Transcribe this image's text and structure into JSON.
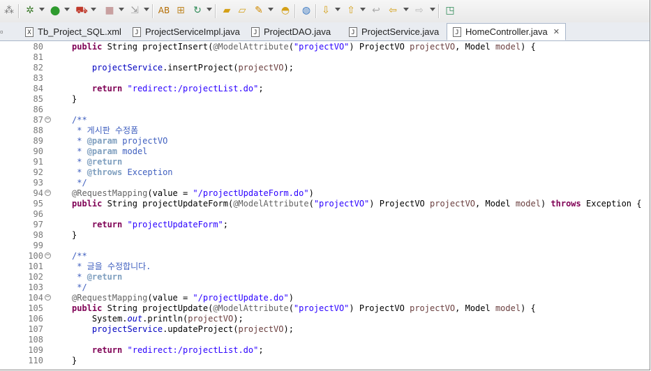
{
  "toolbar": {
    "buttons": [
      "perspective-icon",
      "debug-icon",
      "run-icon",
      "run-server-icon",
      "stop-icon",
      "deploy-icon",
      "build-icon",
      "new-class-icon",
      "refresh-icon",
      "open-folder-icon",
      "open-project-icon",
      "tools-icon",
      "bookmark-icon",
      "globe-icon",
      "next-annotation-icon",
      "prev-annotation-icon",
      "back-icon",
      "back-arrow-icon",
      "forward-arrow-icon",
      "new-window-icon"
    ]
  },
  "tabs": [
    {
      "label": "Tb_Project_SQL.xml",
      "icon": "X"
    },
    {
      "label": "ProjectServiceImpl.java",
      "icon": "J"
    },
    {
      "label": "ProjectDAO.java",
      "icon": "J"
    },
    {
      "label": "ProjectService.java",
      "icon": "J"
    },
    {
      "label": "HomeController.java",
      "icon": "J",
      "active": true,
      "close": "✕"
    }
  ],
  "lines": [
    {
      "n": "80",
      "fold": "",
      "segs": [
        [
          "kw",
          "public"
        ],
        [
          "",
          " String projectInsert("
        ],
        [
          "ann",
          "@ModelAttribute"
        ],
        [
          "",
          "("
        ],
        [
          "str",
          "\"projectVO\""
        ],
        [
          "",
          ") ProjectVO "
        ],
        [
          "var",
          "projectVO"
        ],
        [
          "",
          ", Model "
        ],
        [
          "var",
          "model"
        ],
        [
          "",
          ") {"
        ]
      ]
    },
    {
      "n": "81",
      "fold": "",
      "segs": []
    },
    {
      "n": "82",
      "fold": "",
      "segs": [
        [
          "",
          "    "
        ],
        [
          "fld",
          "projectService"
        ],
        [
          "",
          ".insertProject("
        ],
        [
          "var",
          "projectVO"
        ],
        [
          "",
          ");"
        ]
      ]
    },
    {
      "n": "83",
      "fold": "",
      "segs": []
    },
    {
      "n": "84",
      "fold": "",
      "segs": [
        [
          "",
          "    "
        ],
        [
          "kw",
          "return"
        ],
        [
          "",
          " "
        ],
        [
          "str",
          "\"redirect:/projectList.do\""
        ],
        [
          "",
          ";"
        ]
      ]
    },
    {
      "n": "85",
      "fold": "",
      "segs": [
        [
          "",
          "}"
        ]
      ]
    },
    {
      "n": "86",
      "fold": "",
      "segs": []
    },
    {
      "n": "87",
      "fold": "⊖",
      "segs": [
        [
          "doc",
          "/**"
        ]
      ]
    },
    {
      "n": "88",
      "fold": "",
      "segs": [
        [
          "doc",
          " * 게시판 수정폼"
        ]
      ]
    },
    {
      "n": "89",
      "fold": "",
      "segs": [
        [
          "doc",
          " * "
        ],
        [
          "tag",
          "@param"
        ],
        [
          "doc",
          " projectVO"
        ]
      ]
    },
    {
      "n": "90",
      "fold": "",
      "segs": [
        [
          "doc",
          " * "
        ],
        [
          "tag",
          "@param"
        ],
        [
          "doc",
          " model"
        ]
      ]
    },
    {
      "n": "91",
      "fold": "",
      "segs": [
        [
          "doc",
          " * "
        ],
        [
          "tag",
          "@return"
        ]
      ]
    },
    {
      "n": "92",
      "fold": "",
      "segs": [
        [
          "doc",
          " * "
        ],
        [
          "tag",
          "@throws"
        ],
        [
          "doc",
          " Exception"
        ]
      ]
    },
    {
      "n": "93",
      "fold": "",
      "segs": [
        [
          "doc",
          " */"
        ]
      ]
    },
    {
      "n": "94",
      "fold": "⊖",
      "segs": [
        [
          "ann",
          "@RequestMapping"
        ],
        [
          "",
          "(value = "
        ],
        [
          "str",
          "\"/projectUpdateForm.do\""
        ],
        [
          "",
          ")"
        ]
      ]
    },
    {
      "n": "95",
      "fold": "",
      "segs": [
        [
          "kw",
          "public"
        ],
        [
          "",
          " String projectUpdateForm("
        ],
        [
          "ann",
          "@ModelAttribute"
        ],
        [
          "",
          "("
        ],
        [
          "str",
          "\"projectVO\""
        ],
        [
          "",
          ") ProjectVO "
        ],
        [
          "var",
          "projectVO"
        ],
        [
          "",
          ", Model "
        ],
        [
          "var",
          "model"
        ],
        [
          "",
          ") "
        ],
        [
          "kw",
          "throws"
        ],
        [
          "",
          " Exception {"
        ]
      ]
    },
    {
      "n": "96",
      "fold": "",
      "segs": []
    },
    {
      "n": "97",
      "fold": "",
      "segs": [
        [
          "",
          "    "
        ],
        [
          "kw",
          "return"
        ],
        [
          "",
          " "
        ],
        [
          "str",
          "\"projectUpdateForm\""
        ],
        [
          "",
          ";"
        ]
      ]
    },
    {
      "n": "98",
      "fold": "",
      "segs": [
        [
          "",
          "}"
        ]
      ]
    },
    {
      "n": "99",
      "fold": "",
      "segs": []
    },
    {
      "n": "100",
      "fold": "⊖",
      "segs": [
        [
          "doc",
          "/**"
        ]
      ]
    },
    {
      "n": "101",
      "fold": "",
      "segs": [
        [
          "doc",
          " * 글을 수정합니다."
        ]
      ]
    },
    {
      "n": "102",
      "fold": "",
      "segs": [
        [
          "doc",
          " * "
        ],
        [
          "tag",
          "@return"
        ]
      ]
    },
    {
      "n": "103",
      "fold": "",
      "segs": [
        [
          "doc",
          " */"
        ]
      ]
    },
    {
      "n": "104",
      "fold": "⊖",
      "segs": [
        [
          "ann",
          "@RequestMapping"
        ],
        [
          "",
          "(value = "
        ],
        [
          "str",
          "\"/projectUpdate.do\""
        ],
        [
          "",
          ")"
        ]
      ]
    },
    {
      "n": "105",
      "fold": "",
      "segs": [
        [
          "kw",
          "public"
        ],
        [
          "",
          " String projectUpdate("
        ],
        [
          "ann",
          "@ModelAttribute"
        ],
        [
          "",
          "("
        ],
        [
          "str",
          "\"projectVO\""
        ],
        [
          "",
          ") ProjectVO "
        ],
        [
          "var",
          "projectVO"
        ],
        [
          "",
          ", Model "
        ],
        [
          "var",
          "model"
        ],
        [
          "",
          ") {"
        ]
      ]
    },
    {
      "n": "106",
      "fold": "",
      "segs": [
        [
          "",
          "    System."
        ],
        [
          "fld it",
          "out"
        ],
        [
          "",
          ".println("
        ],
        [
          "var",
          "projectVO"
        ],
        [
          "",
          ");"
        ]
      ]
    },
    {
      "n": "107",
      "fold": "",
      "segs": [
        [
          "",
          "    "
        ],
        [
          "fld",
          "projectService"
        ],
        [
          "",
          ".updateProject("
        ],
        [
          "var",
          "projectVO"
        ],
        [
          "",
          ");"
        ]
      ]
    },
    {
      "n": "108",
      "fold": "",
      "segs": []
    },
    {
      "n": "109",
      "fold": "",
      "segs": [
        [
          "",
          "    "
        ],
        [
          "kw",
          "return"
        ],
        [
          "",
          " "
        ],
        [
          "str",
          "\"redirect:/projectList.do\""
        ],
        [
          "",
          ";"
        ]
      ]
    },
    {
      "n": "110",
      "fold": "",
      "segs": [
        [
          "",
          "}"
        ]
      ]
    }
  ]
}
